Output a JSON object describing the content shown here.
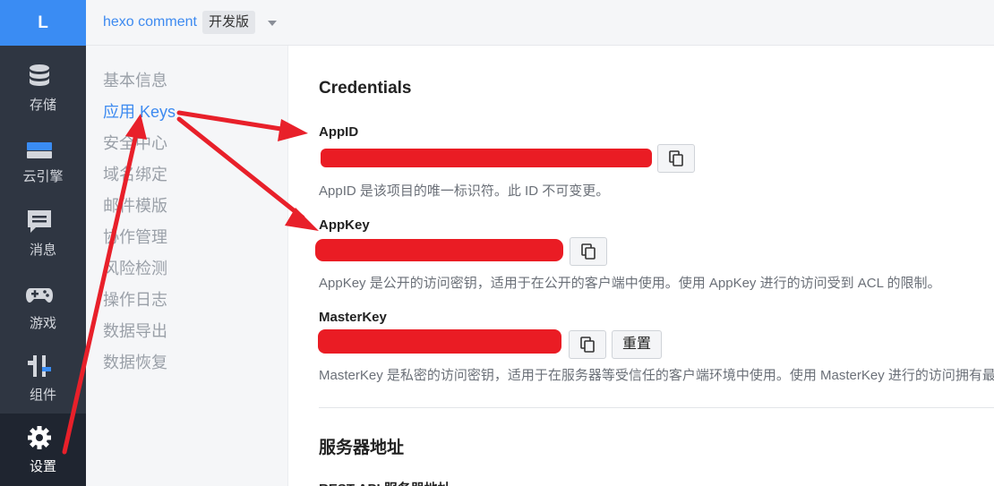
{
  "logo": {
    "letter": "L"
  },
  "rail": {
    "items": [
      {
        "label": "存储",
        "icon": "database-icon"
      },
      {
        "label": "云引擎",
        "icon": "cloud-engine-icon"
      },
      {
        "label": "消息",
        "icon": "message-icon"
      },
      {
        "label": "游戏",
        "icon": "gamepad-icon"
      },
      {
        "label": "组件",
        "icon": "components-icon"
      },
      {
        "label": "设置",
        "icon": "gear-icon",
        "active": true
      }
    ]
  },
  "header": {
    "app_name": "hexo comment",
    "edition_badge": "开发版"
  },
  "subnav": {
    "items": [
      {
        "label": "基本信息"
      },
      {
        "label": "应用 Keys",
        "active": true
      },
      {
        "label": "安全中心"
      },
      {
        "label": "域名绑定"
      },
      {
        "label": "邮件模版"
      },
      {
        "label": "协作管理"
      },
      {
        "label": "风险检测"
      },
      {
        "label": "操作日志"
      },
      {
        "label": "数据导出"
      },
      {
        "label": "数据恢复"
      }
    ]
  },
  "main": {
    "credentials_title": "Credentials",
    "appid": {
      "label": "AppID",
      "help": "AppID 是该项目的唯一标识符。此 ID 不可变更。"
    },
    "appkey": {
      "label": "AppKey",
      "help": "AppKey 是公开的访问密钥，适用于在公开的客户端中使用。使用 AppKey 进行的访问受到 ACL 的限制。"
    },
    "masterkey": {
      "label": "MasterKey",
      "reset_label": "重置",
      "help": "MasterKey 是私密的访问密钥，适用于在服务器等受信任的客户端环境中使用。使用 MasterKey 进行的访问拥有最高权限，不受任何访问限制。"
    },
    "server_title": "服务器地址",
    "rest_label": "REST API 服务器地址"
  },
  "colors": {
    "accent": "#3a8cf3",
    "rail_bg": "#2f3642",
    "redaction": "#ea1c24",
    "annotation_arrow": "#e8202a"
  }
}
